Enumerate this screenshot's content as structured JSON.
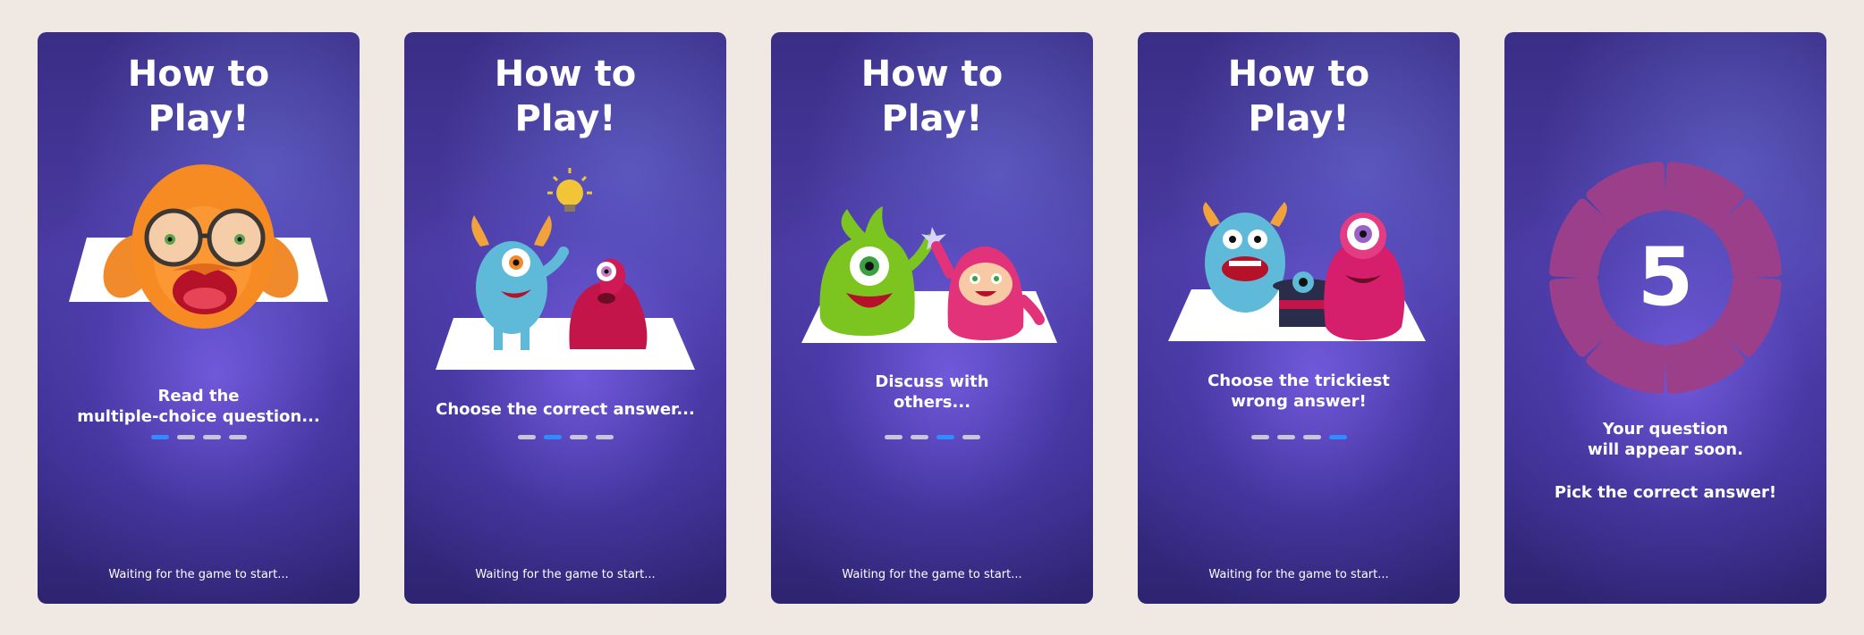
{
  "cards": [
    {
      "title": "How to\nPlay!",
      "caption": "Read the\nmultiple-choice question...",
      "step": 1,
      "waiting": "Waiting for the game to start..."
    },
    {
      "title": "How to\nPlay!",
      "caption": "Choose the correct answer...",
      "step": 2,
      "waiting": "Waiting for the game to start..."
    },
    {
      "title": "How to\nPlay!",
      "caption": "Discuss with\nothers...",
      "step": 3,
      "waiting": "Waiting for the game to start..."
    },
    {
      "title": "How to\nPlay!",
      "caption": "Choose the trickiest\nwrong answer!",
      "step": 4,
      "waiting": "Waiting for the game to start..."
    }
  ],
  "countdown": {
    "number": "5",
    "message": "Your question\nwill appear soon.",
    "instruction": "Pick the correct answer!",
    "segments": 8
  },
  "progress_total": 4,
  "colors": {
    "accent": "#2f8dff",
    "inactive_dot": "#c9c6d8",
    "countdown_segment": "#9c3f8a"
  },
  "icons": [
    "orange-monster-icon",
    "blue-monster-icon",
    "red-monster-icon",
    "lightbulb-icon",
    "green-monster-icon",
    "pink-monster-icon",
    "magic-hat-icon",
    "countdown-ring-icon"
  ]
}
